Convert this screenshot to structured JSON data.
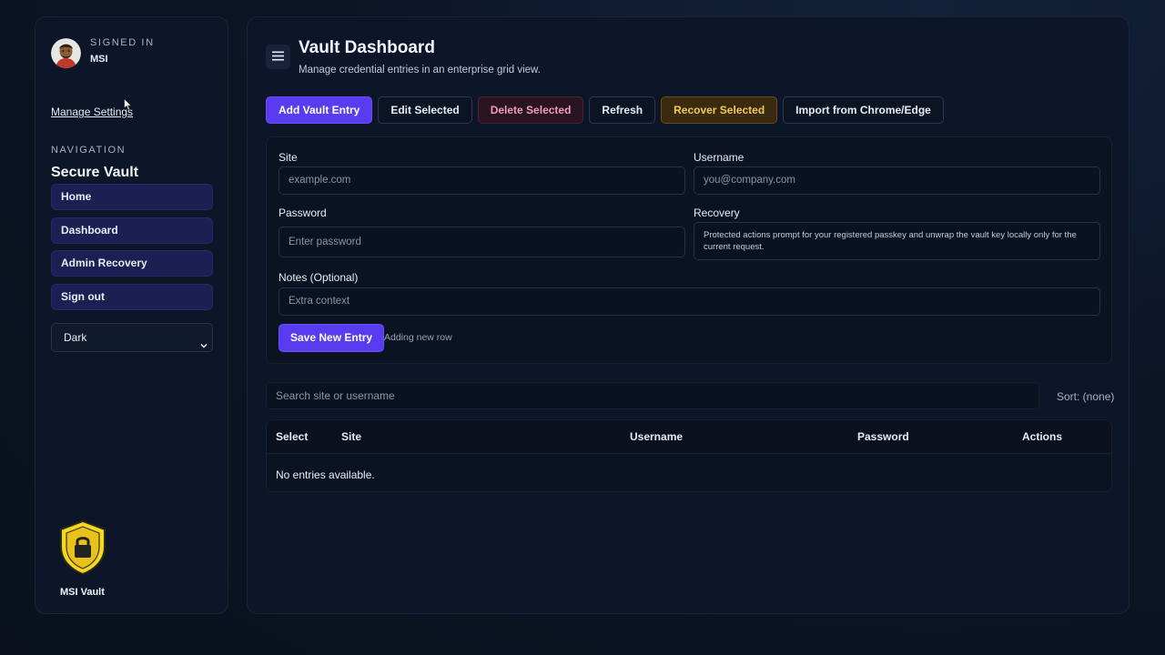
{
  "sidebar": {
    "signed_in_label": "SIGNED IN",
    "user_name": "MSI",
    "manage_settings": "Manage Settings",
    "nav_label": "NAVIGATION",
    "section_title": "Secure Vault",
    "nav_items": [
      {
        "label": "Home"
      },
      {
        "label": "Dashboard"
      },
      {
        "label": "Admin Recovery"
      },
      {
        "label": "Sign out"
      }
    ],
    "theme_select": {
      "value": "Dark"
    },
    "brand_name": "MSI Vault"
  },
  "header": {
    "title": "Vault Dashboard",
    "subtitle": "Manage credential entries in an enterprise grid view."
  },
  "toolbar": {
    "add": "Add Vault Entry",
    "edit": "Edit Selected",
    "delete": "Delete Selected",
    "refresh": "Refresh",
    "recover": "Recover Selected",
    "import": "Import from Chrome/Edge"
  },
  "form": {
    "site_label": "Site",
    "site_placeholder": "example.com",
    "username_label": "Username",
    "username_placeholder": "you@company.com",
    "password_label": "Password",
    "password_placeholder": "Enter password",
    "recovery_label": "Recovery",
    "recovery_text": "Protected actions prompt for your registered passkey and unwrap the vault key locally only for the current request.",
    "notes_label": "Notes (Optional)",
    "notes_placeholder": "Extra context",
    "save_button": "Save New Entry",
    "status": "Adding new row"
  },
  "search": {
    "placeholder": "Search site or username",
    "sort": "Sort: (none)"
  },
  "table": {
    "columns": [
      "Select",
      "Site",
      "Username",
      "Password",
      "Actions"
    ],
    "empty_message": "No entries available."
  },
  "colors": {
    "accent": "#5a3cf0",
    "danger": "#ef9fb1",
    "warning": "#f2c85a",
    "shield": "#f5d623"
  }
}
